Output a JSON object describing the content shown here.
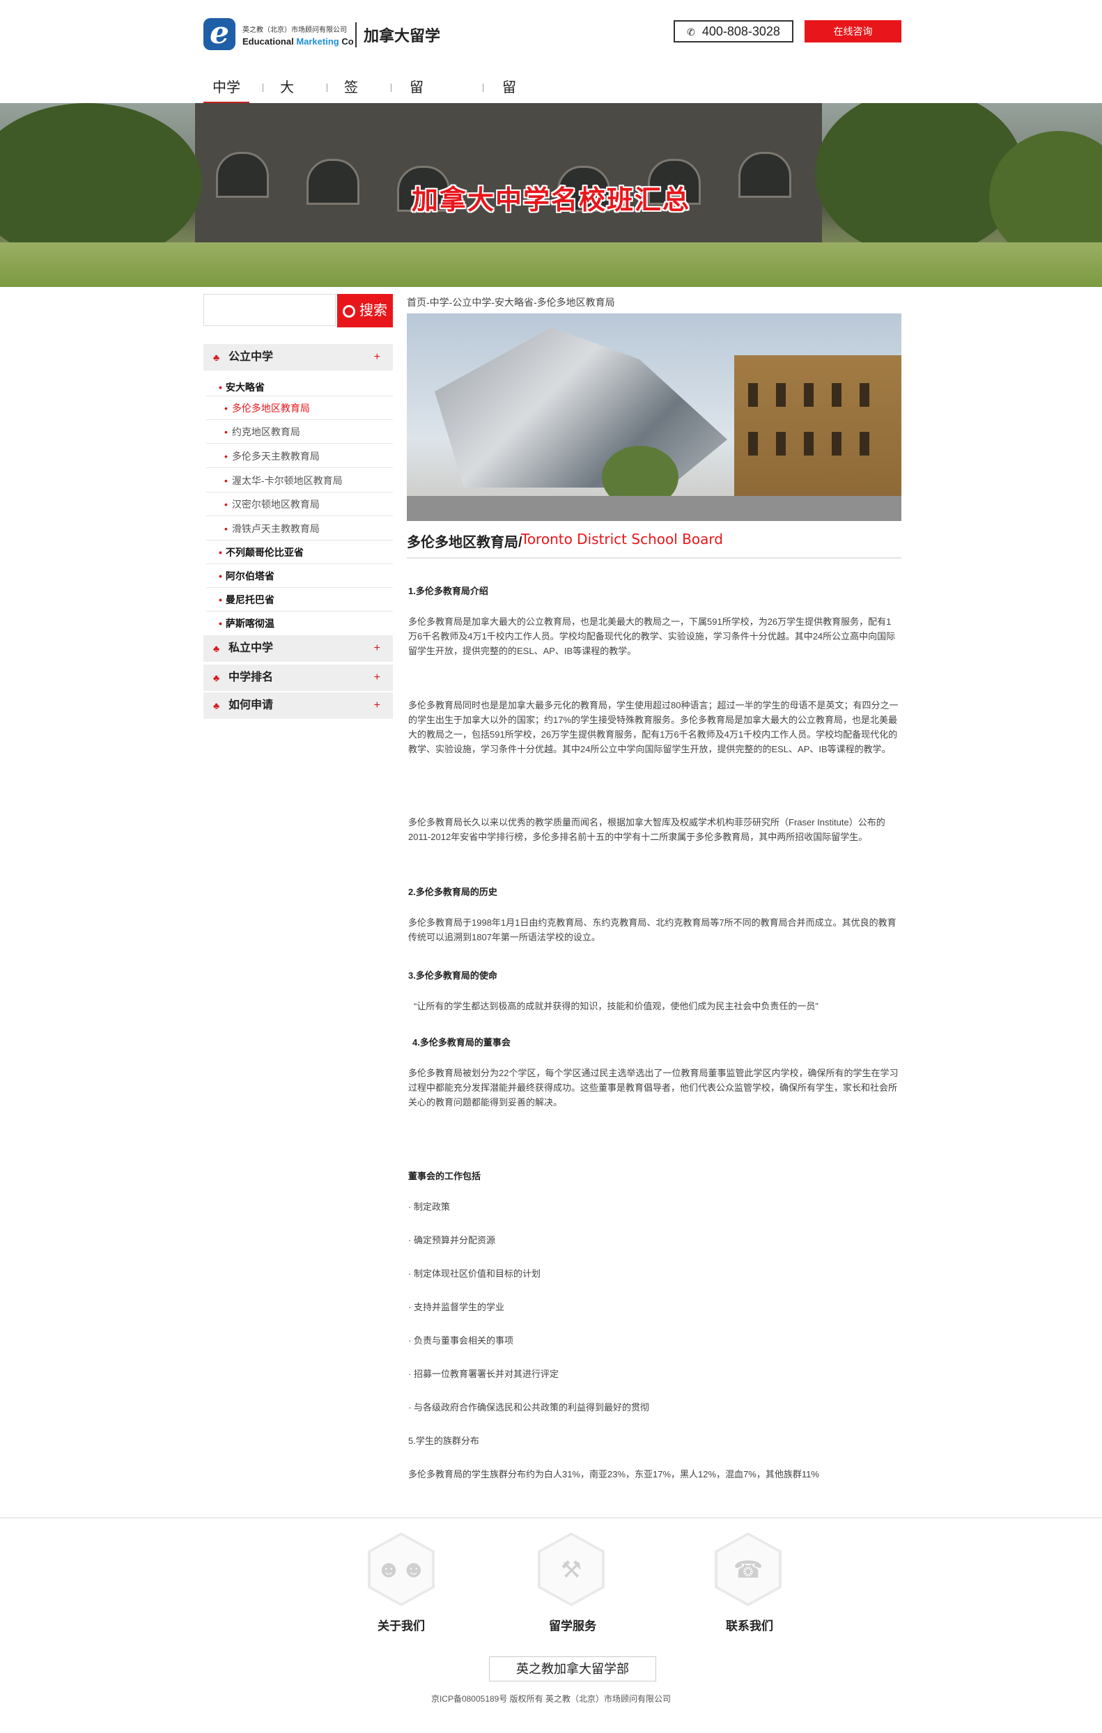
{
  "header": {
    "logo_cn": "英之教（北京）市场顾问有限公司",
    "logo_en_1": "Educational",
    "logo_en_2": "Marketing",
    "logo_en_3": "Co",
    "site_title": "加拿大留学",
    "phone": "400-808-3028",
    "consult": "在线咨询"
  },
  "nav": [
    "中学",
    "大学",
    "签证",
    "留学经验",
    "留学服务"
  ],
  "banner": {
    "title": "加拿大中学名校班汇总"
  },
  "search": {
    "button": "搜索"
  },
  "sidebar": {
    "sections": [
      {
        "label": "公立中学",
        "toggle": "+"
      },
      {
        "label": "私立中学",
        "toggle": "+"
      },
      {
        "label": "中学排名",
        "toggle": "+"
      },
      {
        "label": "如何申请",
        "toggle": "+"
      }
    ],
    "provinces": [
      "安大略省",
      "不列颠哥伦比亚省",
      "阿尔伯塔省",
      "曼尼托巴省",
      "萨斯喀彻温"
    ],
    "boards": [
      "多伦多地区教育局",
      "约克地区教育局",
      "多伦多天主教教育局",
      "渥太华-卡尔顿地区教育局",
      "汉密尔顿地区教育局",
      "滑铁卢天主教教育局"
    ]
  },
  "content": {
    "breadcrumb": "首页-中学-公立中学-安大略省-多伦多地区教育局",
    "title_cn": "多伦多地区教育局/",
    "title_en": "Toronto District School Board",
    "h1": "1.多伦多教育局介绍",
    "p1": "多伦多教育局是加拿大最大的公立教育局，也是北美最大的教局之一，下属591所学校，为26万学生提供教育服务，配有1万6千名教师及4万1千校内工作人员。学校均配备现代化的教学、实验设施，学习条件十分优越。其中24所公立高中向国际留学生开放，提供完整的的ESL、AP、IB等课程的教学。",
    "p2": "多伦多教育局同时也是是加拿大最多元化的教育局，学生使用超过80种语言；超过一半的学生的母语不是英文；有四分之一的学生出生于加拿大以外的国家；约17%的学生接受特殊教育服务。多伦多教育局是加拿大最大的公立教育局，也是北美最大的教局之一，包括591所学校，26万学生提供教育服务，配有1万6千名教师及4万1千校内工作人员。学校均配备现代化的教学、实验设施，学习条件十分优越。其中24所公立中学向国际留学生开放，提供完整的的ESL、AP、IB等课程的教学。",
    "p3": "多伦多教育局长久以来以优秀的教学质量而闻名，根据加拿大智库及权威学术机构菲莎研究所（Fraser Institute）公布的2011-2012年安省中学排行榜，多伦多排名前十五的中学有十二所隶属于多伦多教育局，其中两所招收国际留学生。",
    "h2": "2.多伦多教育局的历史",
    "p4": "多伦多教育局于1998年1月1日由约克教育局、东约克教育局、北约克教育局等7所不同的教育局合并而成立。其优良的教育传统可以追溯到1807年第一所语法学校的设立。",
    "h3": "3.多伦多教育局的使命",
    "p5": "“让所有的学生都达到极高的成就并获得的知识，技能和价值观，使他们成为民主社会中负责任的一员”",
    "h4": "4.多伦多教育局的董事会",
    "p6": "多伦多教育局被划分为22个学区，每个学区通过民主选举选出了一位教育局董事监管此学区内学校，确保所有的学生在学习过程中都能充分发挥潜能并最终获得成功。这些董事是教育倡导者，他们代表公众监管学校，确保所有学生，家长和社会所关心的教育问题都能得到妥善的解决。",
    "h5": "董事会的工作包括",
    "duties": [
      "· 制定政策",
      "· 确定预算并分配资源",
      "· 制定体现社区价值和目标的计划",
      "· 支持并监督学生的学业",
      "· 负责与董事会相关的事项",
      "· 招募一位教育署署长并对其进行评定",
      "· 与各级政府合作确保选民和公共政策的利益得到最好的贯彻"
    ],
    "h6": "5.学生的族群分布",
    "p7": "多伦多教育局的学生族群分布约为白人31%，南亚23%，东亚17%，黑人12%，混血7%，其他族群11%"
  },
  "footer": {
    "items": [
      {
        "label": "关于我们",
        "icon": "people-icon"
      },
      {
        "label": "留学服务",
        "icon": "meeting-icon"
      },
      {
        "label": "联系我们",
        "icon": "telephone-icon"
      }
    ],
    "box": "英之教加拿大留学部",
    "copyright": "京ICP备08005189号 版权所有 英之教（北京）市场顾问有限公司"
  }
}
